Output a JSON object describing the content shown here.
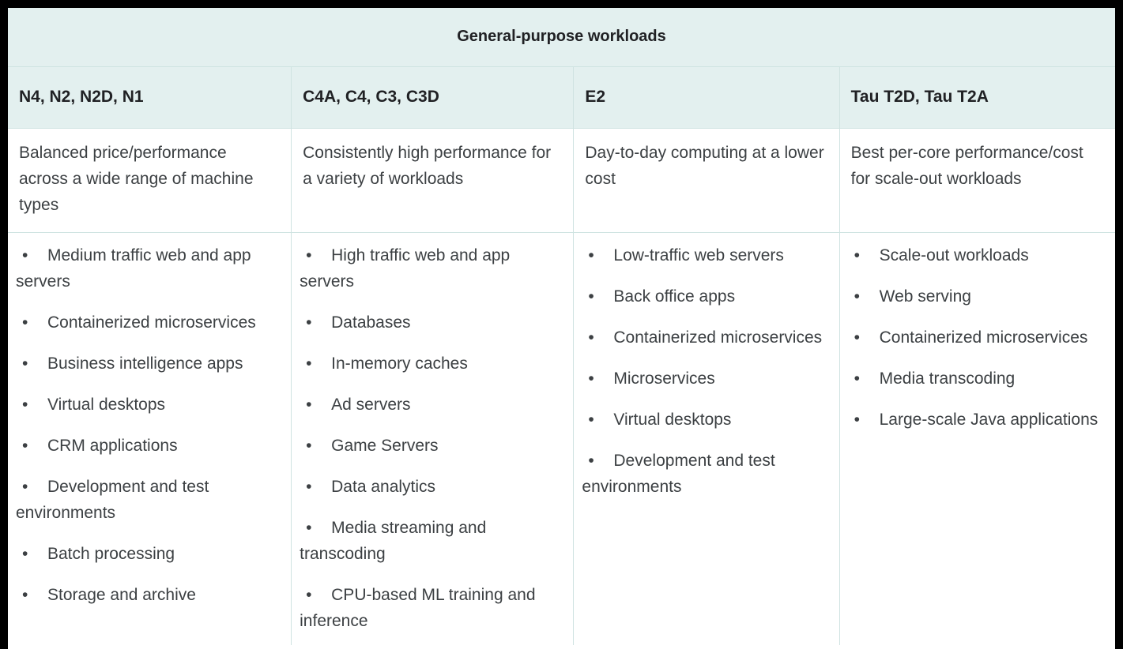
{
  "table": {
    "title": "General-purpose workloads",
    "columns": [
      {
        "header": "N4, N2, N2D, N1",
        "description": "Balanced price/performance across a wide range of machine types",
        "bullet_char": "•",
        "items": [
          "Medium traffic web and app servers",
          "Containerized microservices",
          "Business intelligence apps",
          "Virtual desktops",
          "CRM applications",
          "Development and test environments",
          "Batch processing",
          "Storage and archive"
        ]
      },
      {
        "header": "C4A, C4, C3, C3D",
        "description": "Consistently high performance for a variety of workloads",
        "bullet_char": "•",
        "items": [
          "High traffic web and app servers",
          "Databases",
          "In-memory caches",
          "Ad servers",
          "Game Servers",
          "Data analytics",
          "Media streaming and transcoding",
          "CPU-based ML training and inference"
        ]
      },
      {
        "header": "E2",
        "description": "Day-to-day computing at a lower cost",
        "bullet_char": "•",
        "items": [
          "Low-traffic web servers",
          "Back office apps",
          "Containerized microservices",
          "Microservices",
          "Virtual desktops",
          "Development and test environments"
        ]
      },
      {
        "header": "Tau T2D, Tau T2A",
        "description": "Best per-core performance/cost for scale-out workloads",
        "bullet_char": "•",
        "items": [
          "Scale-out workloads",
          "Web serving",
          "Containerized microservices",
          "Media transcoding",
          "Large-scale Java applications"
        ]
      }
    ]
  },
  "colors": {
    "header_background": "#e3f0ef",
    "grid_line": "#cfe3e1",
    "frame": "#000000",
    "body_text": "#3c4043",
    "header_text": "#202124",
    "cell_background": "#ffffff"
  }
}
